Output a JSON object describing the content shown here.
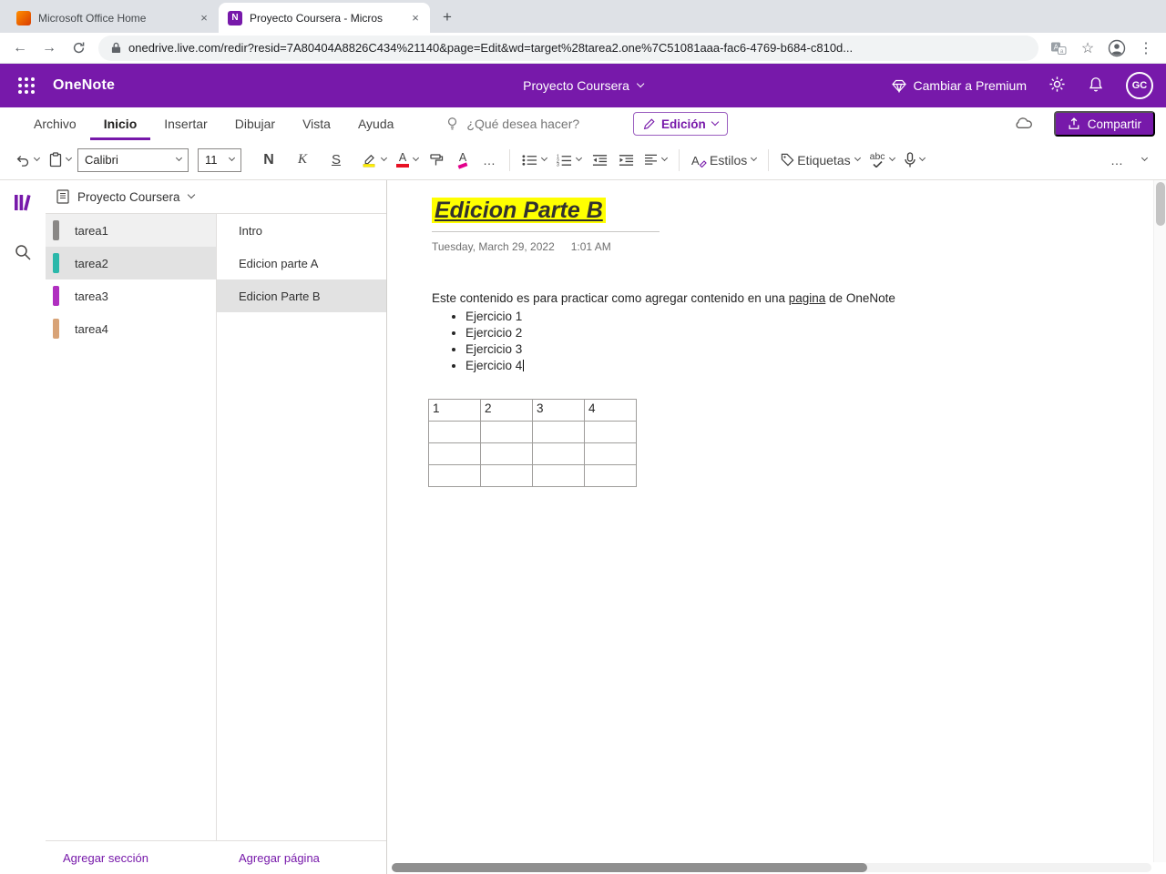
{
  "icons": {
    "close": "×",
    "new_tab": "+",
    "back": "←",
    "forward": "→",
    "menu": "⋮",
    "star": "☆",
    "overflow": "…",
    "onenote_letter": "N"
  },
  "browser": {
    "tabs": [
      {
        "title": "Microsoft Office Home"
      },
      {
        "title": "Proyecto Coursera - Micros"
      }
    ],
    "url": "onedrive.live.com/redir?resid=7A80404A8826C434%21140&page=Edit&wd=target%28tarea2.one%7C51081aaa-fac6-4769-b684-c810d..."
  },
  "header": {
    "app_name": "OneNote",
    "document_title": "Proyecto Coursera",
    "premium_label": "Cambiar a Premium",
    "avatar_initials": "GC"
  },
  "ribbon": {
    "tabs": [
      {
        "label": "Archivo"
      },
      {
        "label": "Inicio"
      },
      {
        "label": "Insertar"
      },
      {
        "label": "Dibujar"
      },
      {
        "label": "Vista"
      },
      {
        "label": "Ayuda"
      }
    ],
    "active_tab": "Inicio",
    "help_text": "¿Qué desea hacer?",
    "mode_button": "Edición",
    "share_button": "Compartir"
  },
  "toolbar": {
    "font_name": "Calibri",
    "font_size": "11",
    "bold": "N",
    "italic": "K",
    "underline": "S",
    "font_color_glyph": "A",
    "clear_format_glyph": "A",
    "styles_label": "Estilos",
    "styles_glyph": "A",
    "tags_label": "Etiquetas",
    "spellcheck_label": "abc"
  },
  "sidebar": {
    "notebook_name": "Proyecto Coursera",
    "sections": [
      {
        "name": "tarea1",
        "color": "#8a8886"
      },
      {
        "name": "tarea2",
        "color": "#2bb8aa"
      },
      {
        "name": "tarea3",
        "color": "#b02fc0"
      },
      {
        "name": "tarea4",
        "color": "#d8a377"
      }
    ],
    "selected_section": "tarea2",
    "pages": [
      {
        "name": "Intro"
      },
      {
        "name": "Edicion parte A"
      },
      {
        "name": "Edicion Parte B"
      }
    ],
    "selected_page": "Edicion Parte B",
    "add_section_label": "Agregar sección",
    "add_page_label": "Agregar página"
  },
  "page": {
    "title": "Edicion Parte B",
    "date": "Tuesday, March 29, 2022",
    "time": "1:01 AM",
    "body_prefix": "Este contenido es para practicar como agregar contenido en una ",
    "body_link": "pagina",
    "body_suffix": " de OneNote",
    "bullets": [
      {
        "text": "Ejercicio 1"
      },
      {
        "text": "Ejercicio 2"
      },
      {
        "text": "Ejercicio 3"
      },
      {
        "text": "Ejercicio 4"
      }
    ],
    "table": {
      "headers": [
        {
          "label": "1"
        },
        {
          "label": "2"
        },
        {
          "label": "3"
        },
        {
          "label": "4"
        }
      ],
      "empty_rows": 3
    }
  },
  "colors": {
    "brand": "#7719aa",
    "title_highlight": "#ffff00",
    "font_color_swatch": "#e81123",
    "highlighter_swatch": "#ffef00"
  }
}
